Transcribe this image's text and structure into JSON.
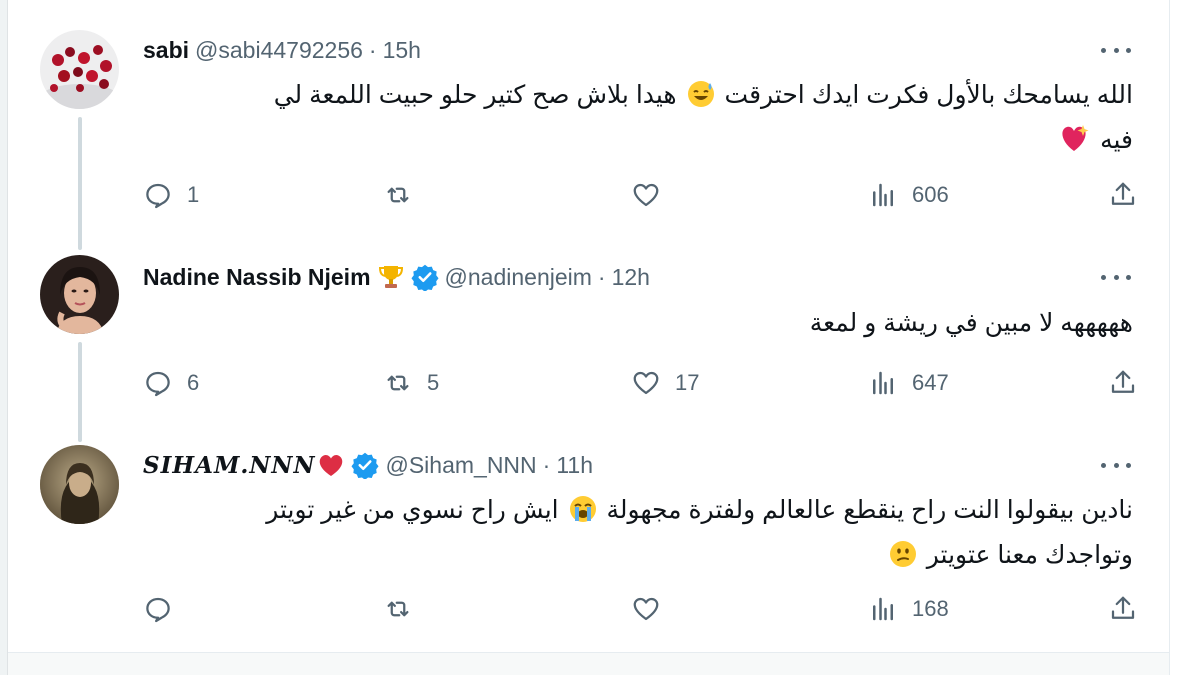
{
  "tweets": [
    {
      "name": "sabi",
      "handle": "@sabi44792256",
      "time": "15h",
      "verified": false,
      "name_emoji": "",
      "text_line1": "الله يسامحك بالأول فكرت ايدك احترقت",
      "text_line1_after": "هيدا بلاش صح كتير حلو حبيت اللمعة لي",
      "text_line2": "فيه",
      "inline_icons": [
        "sweat-smile-emoji",
        "sparkling-heart-emoji"
      ],
      "stats": {
        "replies": "1",
        "retweets": "",
        "likes": "",
        "views": "606"
      }
    },
    {
      "name": "Nadine Nassib Njeim",
      "handle": "@nadinenjeim",
      "time": "12h",
      "verified": true,
      "name_emoji": "trophy-emoji",
      "text_line1": "هههههه لا مبين في ريشة و لمعة",
      "stats": {
        "replies": "6",
        "retweets": "5",
        "likes": "17",
        "views": "647"
      }
    },
    {
      "name": "SIHAM.NNN",
      "handle": "@Siham_NNN",
      "time": "11h",
      "verified": true,
      "name_emoji": "red-heart-emoji",
      "text_line1": "نادين بيقولوا النت راح ينقطع عالعالم ولفترة مجهولة",
      "text_line1_after": "ايش راح نسوي من غير تويتر",
      "text_line2": "وتواجدك معنا عتويتر",
      "inline_icons": [
        "loudly-crying-emoji",
        "confused-face-emoji"
      ],
      "stats": {
        "replies": "",
        "retweets": "",
        "likes": "",
        "views": "168"
      }
    }
  ],
  "separator": "·",
  "icons": [
    "reply-icon",
    "retweet-icon",
    "like-icon",
    "views-icon",
    "share-icon",
    "more-icon",
    "verified-badge-icon"
  ],
  "colors": {
    "text": "#0f1419",
    "secondary": "#536471",
    "verified": "#1d9bf0",
    "thread_line": "#cfd9de"
  }
}
